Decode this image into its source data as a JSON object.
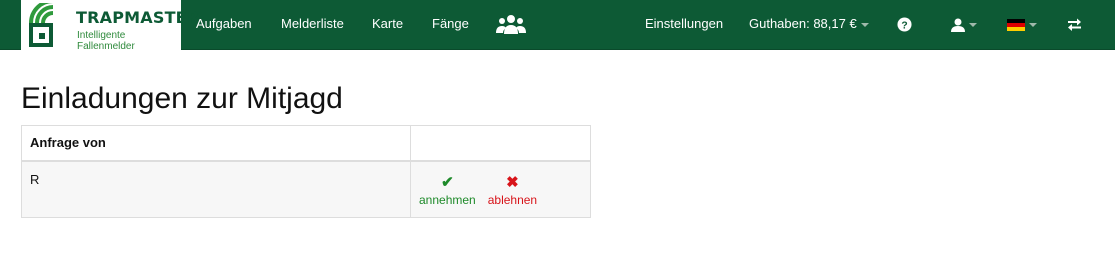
{
  "brand": {
    "name": "TRAPMASTER",
    "tagline": "Intelligente Fallenmelder"
  },
  "nav": {
    "items": [
      "Aufgaben",
      "Melderliste",
      "Karte",
      "Fänge"
    ],
    "group_icon": "users-icon",
    "settings": "Einstellungen",
    "balance": "Guthaben: 88,17 €",
    "help_icon": "question-circle-icon",
    "user_icon": "user-icon",
    "language_icon": "flag-de-icon",
    "switch_icon": "exchange-icon"
  },
  "page": {
    "title": "Einladungen zur Mitjagd"
  },
  "table": {
    "headers": [
      "Anfrage von",
      ""
    ],
    "rows": [
      {
        "requester": "R",
        "accept_label": "annehmen",
        "reject_label": "ablehnen"
      }
    ]
  },
  "colors": {
    "navbar": "#0d5a35",
    "accept": "#1e8a2a",
    "reject": "#d8141a"
  }
}
